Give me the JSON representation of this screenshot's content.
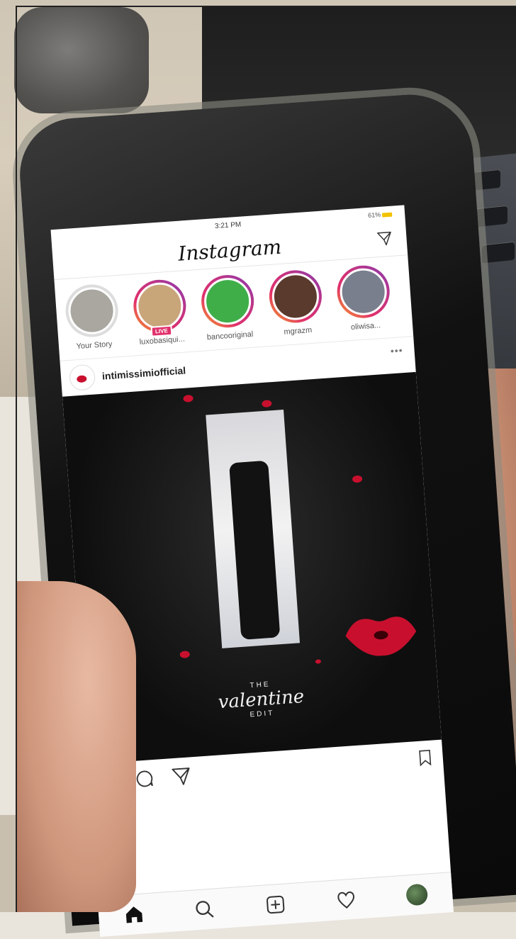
{
  "status_bar": {
    "time": "3:21 PM",
    "battery": "61%"
  },
  "header": {
    "logo_text": "Instagram"
  },
  "stories": [
    {
      "name": "Your Story",
      "ring": "seen",
      "live": false,
      "avatar_color": "#a9a7a0"
    },
    {
      "name": "luxobasiqui...",
      "ring": "active",
      "live": true,
      "avatar_color": "#c9a57a"
    },
    {
      "name": "bancooriginal",
      "ring": "active",
      "live": false,
      "avatar_color": "#3fae49"
    },
    {
      "name": "mgrazm",
      "ring": "active",
      "live": false,
      "avatar_color": "#5a3a2c"
    },
    {
      "name": "oliwisa...",
      "ring": "active",
      "live": false,
      "avatar_color": "#7a7f8e"
    }
  ],
  "live_badge": "LIVE",
  "post": {
    "username": "intimissimiofficial",
    "more": "•••",
    "media": {
      "small_text": "THE",
      "script_text": "valentine",
      "small_text_2": "EDIT"
    }
  },
  "colors": {
    "accent_red": "#c8102e",
    "story_gradient": [
      "#f5a623",
      "#e1306c",
      "#c13584",
      "#833ab4"
    ]
  },
  "icons": [
    "direct-message-icon",
    "heart-icon",
    "comment-icon",
    "send-icon",
    "bookmark-icon",
    "mute-icon",
    "home-icon",
    "search-icon",
    "add-post-icon",
    "activity-heart-icon",
    "profile-avatar-icon"
  ]
}
